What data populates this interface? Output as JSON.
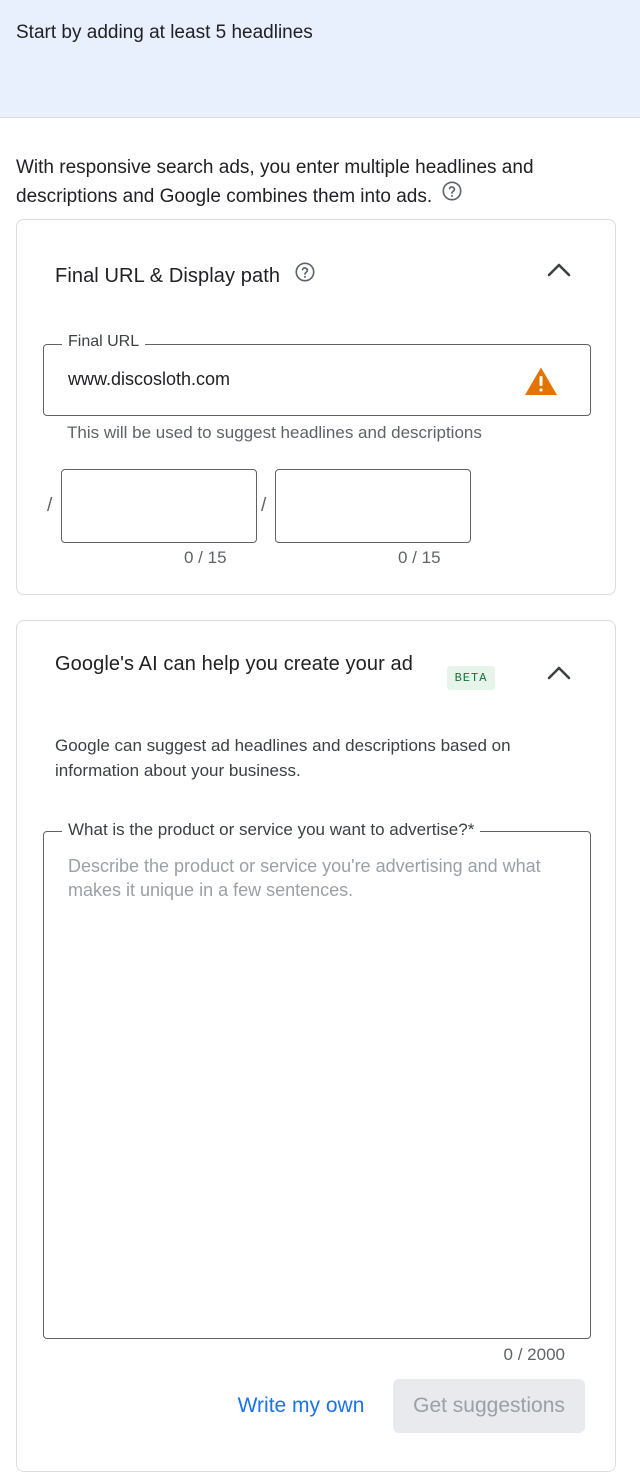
{
  "banner": {
    "text": "Start by adding at least 5 headlines"
  },
  "intro": {
    "text": "With responsive search ads, you enter multiple headlines and descriptions and Google combines them into ads."
  },
  "url_card": {
    "title": "Final URL & Display path",
    "final_url": {
      "label": "Final URL",
      "value": "www.discosloth.com",
      "helper": "This will be used to suggest headlines and descriptions",
      "status_icon": "warning-icon",
      "status_color": "#e37400"
    },
    "display_path": {
      "separator": "/",
      "path1": {
        "value": "",
        "count": "0 / 15"
      },
      "path2": {
        "value": "",
        "count": "0 / 15"
      }
    }
  },
  "ai_card": {
    "title": "Google's AI can help you create your ad",
    "badge": "BETA",
    "description": "Google can suggest ad headlines and descriptions based on information about your business.",
    "prompt": {
      "label": "What is the product or service you want to advertise?*",
      "placeholder": "Describe the product or service you're advertising and what makes it unique in a few sentences.",
      "value": "",
      "count": "0 / 2000"
    },
    "write_own_label": "Write my own",
    "get_suggestions_label": "Get suggestions"
  },
  "colors": {
    "banner_bg": "#e8f0fe",
    "link_blue": "#1a73e8",
    "beta_green": "#137333",
    "warning_orange": "#e37400"
  }
}
